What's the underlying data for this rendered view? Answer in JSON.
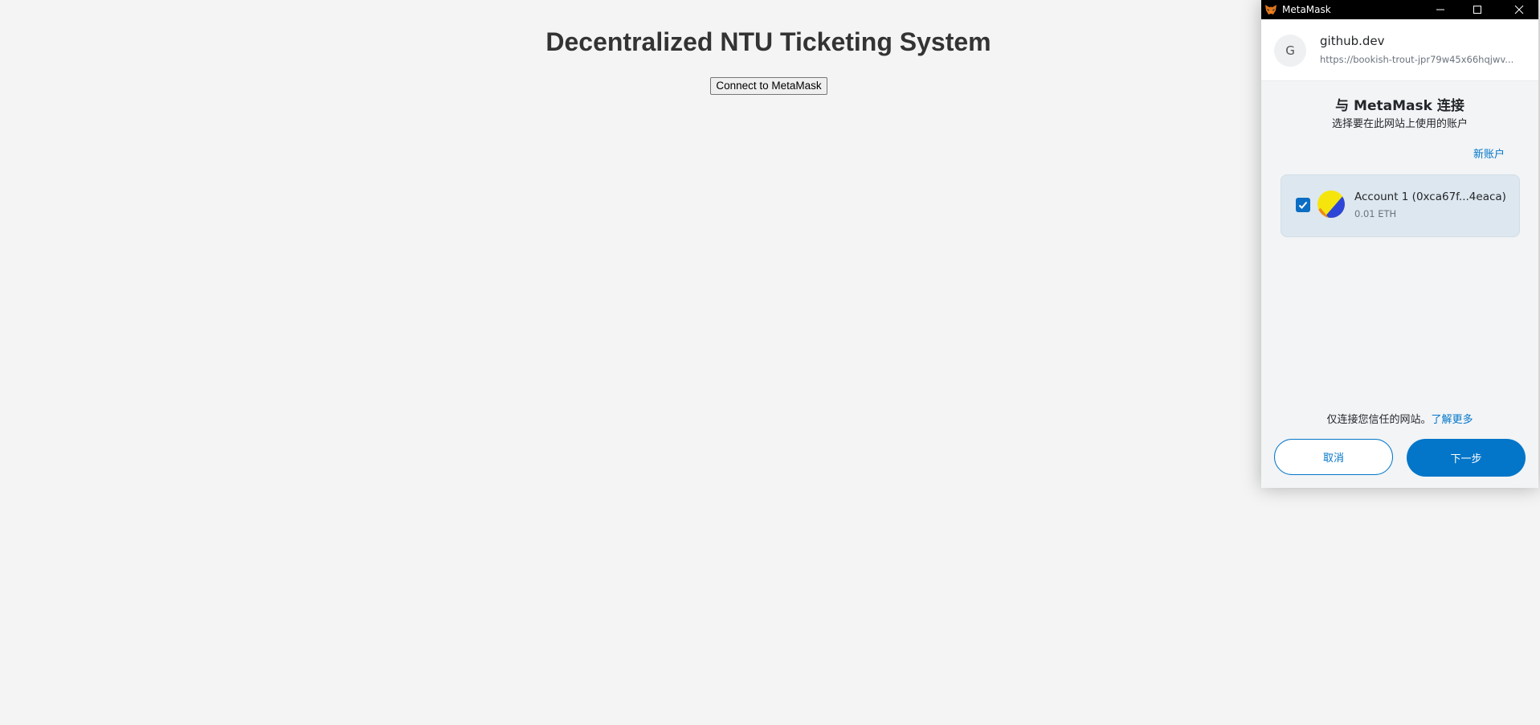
{
  "page": {
    "title": "Decentralized NTU Ticketing System",
    "connect_button": "Connect to MetaMask"
  },
  "metamask": {
    "window_title": "MetaMask",
    "window_controls": [
      "minimize-icon",
      "maximize-icon",
      "close-icon"
    ],
    "site": {
      "avatar_letter": "G",
      "name": "github.dev",
      "url": "https://bookish-trout-jpr79w45x66hqjwv..."
    },
    "heading": "与 MetaMask 连接",
    "subheading": "选择要在此网站上使用的账户",
    "new_account": "新账户",
    "accounts": [
      {
        "name": "Account 1 (0xca67f...4eaca)",
        "balance": "0.01 ETH",
        "checked": true
      }
    ],
    "trust_note": "仅连接您信任的网站。",
    "learn_more": "了解更多",
    "cancel_button": "取消",
    "next_button": "下一步",
    "colors": {
      "accent": "#0376c9",
      "card_bg": "#dde7ef",
      "titlebar": "#000000"
    }
  }
}
